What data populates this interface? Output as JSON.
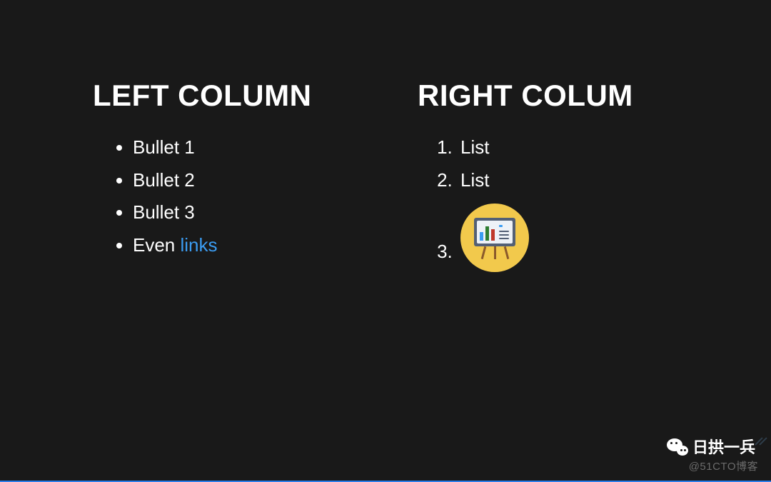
{
  "left": {
    "heading": "LEFT COLUMN",
    "bullets": [
      "Bullet 1",
      "Bullet 2",
      "Bullet 3"
    ],
    "last_prefix": "Even ",
    "last_link": "links"
  },
  "right": {
    "heading": "RIGHT COLUM",
    "items": [
      "List",
      "List"
    ],
    "third_label": ""
  },
  "watermark": {
    "brand": "日拱一兵",
    "sub": "@51CTO博客"
  }
}
